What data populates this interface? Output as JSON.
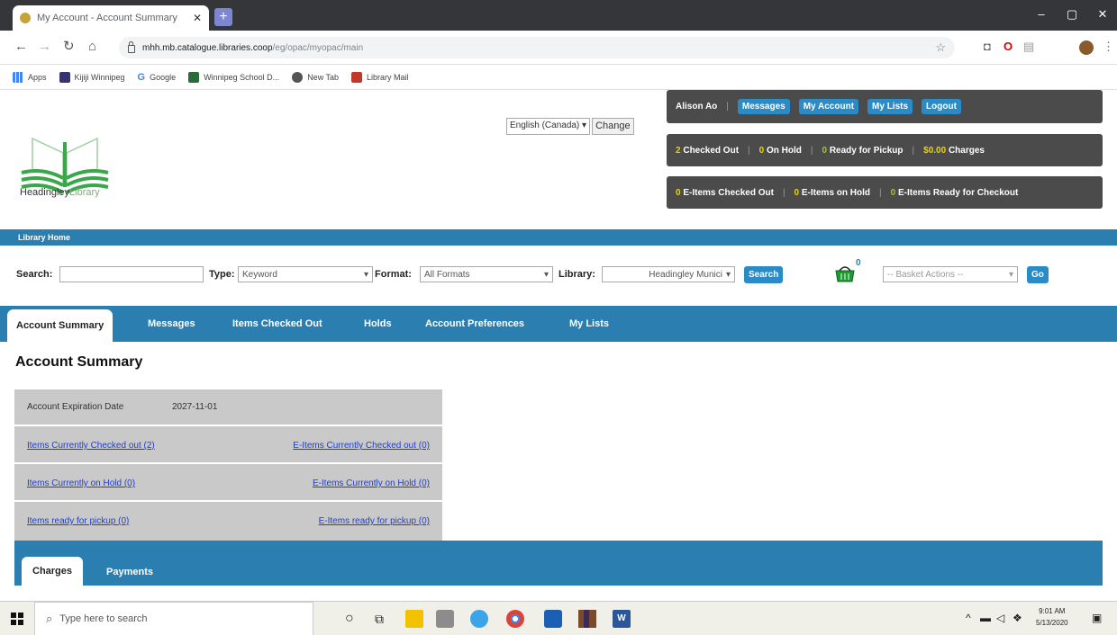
{
  "browser": {
    "tab_title": "My Account - Account Summary",
    "tab_close": "✕",
    "new_tab": "+",
    "window_controls": {
      "minimize": "–",
      "maximize": "▢",
      "close": "✕"
    },
    "url_host": "mhh.mb.catalogue.libraries.coop",
    "url_path": "/eg/opac/myopac/main",
    "bookmarks": [
      {
        "label": "Apps",
        "icon": "apps-grid-icon",
        "color": "#4285f4"
      },
      {
        "label": "Kijiji Winnipeg",
        "icon": "kijiji-icon",
        "color": "#373373"
      },
      {
        "label": "Google",
        "icon": "google-icon",
        "color": "#4285f4"
      },
      {
        "label": "Winnipeg School D...",
        "icon": "school-icon",
        "color": "#2a6b3a"
      },
      {
        "label": "New Tab",
        "icon": "new-tab-icon",
        "color": "#555555"
      },
      {
        "label": "Library Mail",
        "icon": "mail-icon",
        "color": "#c0392b"
      }
    ]
  },
  "header": {
    "logo_text_main": "Headingley",
    "logo_text_sub": "Library",
    "language": "English (Canada)",
    "change_button": "Change"
  },
  "user_bar": {
    "user_name": "Alison Ao",
    "messages": "Messages",
    "my_account": "My Account",
    "my_lists": "My Lists",
    "logout": "Logout"
  },
  "status_bar": {
    "checked_out_count": "2",
    "checked_out_label": "Checked Out",
    "on_hold_count": "0",
    "on_hold_label": "On Hold",
    "ready_count": "0",
    "ready_label": "Ready for Pickup",
    "charges_amount": "$0.00",
    "charges_label": "Charges"
  },
  "eitems_bar": {
    "checked_out_count": "0",
    "checked_out_label": "E-Items Checked Out",
    "on_hold_count": "0",
    "on_hold_label": "E-Items on Hold",
    "ready_count": "0",
    "ready_label": "E-Items Ready for Checkout"
  },
  "library_home": "Library Home",
  "search": {
    "search_label": "Search:",
    "type_label": "Type:",
    "type_value": "Keyword",
    "format_label": "Format:",
    "format_value": "All Formats",
    "library_label": "Library:",
    "library_value": "Headingley Munici",
    "search_button": "Search",
    "basket_count": "0",
    "basket_actions": "-- Basket Actions --",
    "go_button": "Go"
  },
  "tabs": [
    "Account Summary",
    "Messages",
    "Items Checked Out",
    "Holds",
    "Account Preferences",
    "My Lists"
  ],
  "page_title": "Account Summary",
  "summary": {
    "expiration_label": "Account Expiration Date",
    "expiration_value": "2027-11-01",
    "checked_out_link": "Items Currently Checked out (2)",
    "e_checked_out_link": "E-Items Currently Checked out (0)",
    "on_hold_link": "Items Currently on Hold (0)",
    "e_on_hold_link": "E-Items Currently on Hold (0)",
    "ready_link": "Items ready for pickup (0)",
    "e_ready_link": "E-Items ready for pickup (0)"
  },
  "charges_tabs": [
    "Charges",
    "Payments"
  ],
  "taskbar": {
    "search_placeholder": "Type here to search",
    "time": "9:01 AM",
    "date": "5/13/2020"
  },
  "colors": {
    "accent_blue": "#2b7fb0",
    "button_blue": "#2b8bc6",
    "dark_bar": "#4b4b4b",
    "link": "#1f3fcc"
  }
}
